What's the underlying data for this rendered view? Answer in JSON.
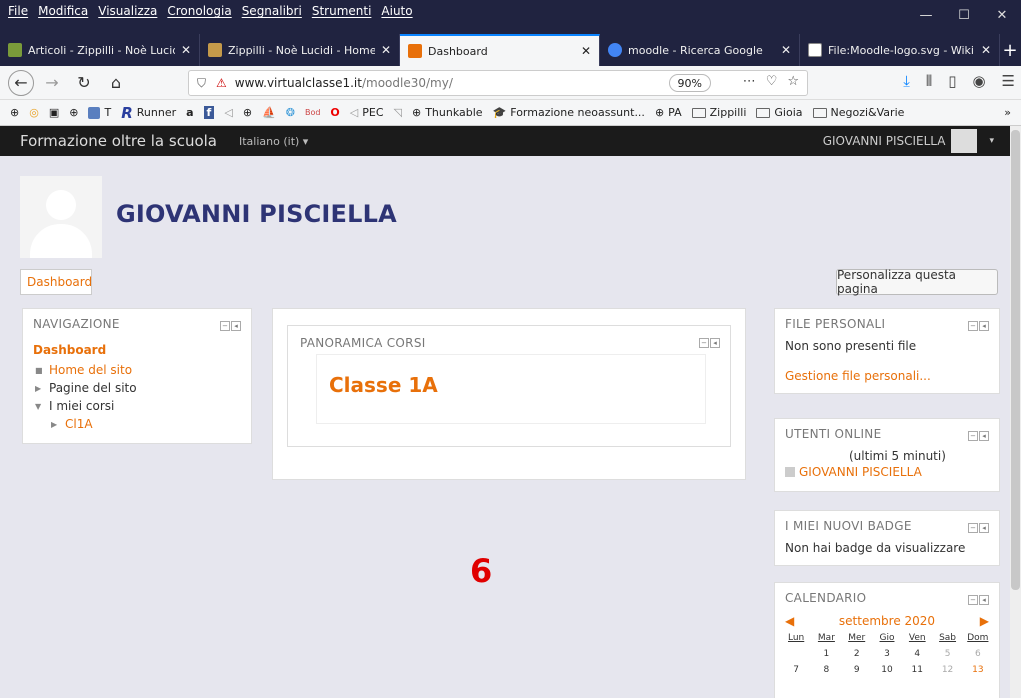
{
  "menu": [
    "File",
    "Modifica",
    "Visualizza",
    "Cronologia",
    "Segnalibri",
    "Strumenti",
    "Aiuto"
  ],
  "tabs": [
    {
      "label": "Articoli - Zippilli - Noè Lucidi -",
      "color": "#7a9b3a",
      "active": false
    },
    {
      "label": "Zippilli - Noè Lucidi - Home",
      "color": "#c59a4a",
      "active": false
    },
    {
      "label": "Dashboard",
      "color": "#e8700a",
      "active": true
    },
    {
      "label": "moodle - Ricerca Google",
      "color": "#4285f4",
      "active": false
    },
    {
      "label": "File:Moodle-logo.svg - Wikipe",
      "color": "#444444",
      "active": false
    }
  ],
  "url": {
    "domain": "www.virtualclasse1.it",
    "path": "/moodle30/my/",
    "zoom": "90%"
  },
  "bookmarks": [
    "T",
    "Runner",
    "PEC",
    "Thunkable",
    "Formazione neoassunt...",
    "PA",
    "Zippilli",
    "Gioia",
    "Negozi&Varie"
  ],
  "moodle": {
    "brand": "Formazione oltre la scuola",
    "language": "Italiano (it) ▾",
    "user": "GIOVANNI PISCIELLA",
    "fullname": "GIOVANNI PISCIELLA",
    "dashboard_button": "Dashboard",
    "customize_button": "Personalizza questa pagina"
  },
  "navigation": {
    "title": "NAVIGAZIONE",
    "current": "Dashboard",
    "items": [
      {
        "label": "Home del sito",
        "link": true
      },
      {
        "label": "Pagine del sito",
        "link": false
      },
      {
        "label": "I miei corsi",
        "link": false
      },
      {
        "label": "Cl1A",
        "link": true
      }
    ]
  },
  "courses": {
    "title": "PANORAMICA CORSI",
    "course": "Classe 1A",
    "annotation": "6"
  },
  "files": {
    "title": "FILE PERSONALI",
    "empty": "Non sono presenti file",
    "manage": "Gestione file personali..."
  },
  "online": {
    "title": "UTENTI ONLINE",
    "period": "(ultimi 5 minuti)",
    "user": "GIOVANNI PISCIELLA"
  },
  "badges": {
    "title": "I MIEI NUOVI BADGE",
    "empty": "Non hai badge da visualizzare"
  },
  "calendar": {
    "title": "CALENDARIO",
    "month": "settembre 2020",
    "days": [
      "Lun",
      "Mar",
      "Mer",
      "Gio",
      "Ven",
      "Sab",
      "Dom"
    ],
    "week1": [
      "",
      "1",
      "2",
      "3",
      "4",
      "5",
      "6"
    ],
    "week2": [
      "7",
      "8",
      "9",
      "10",
      "11",
      "12",
      "13"
    ]
  }
}
